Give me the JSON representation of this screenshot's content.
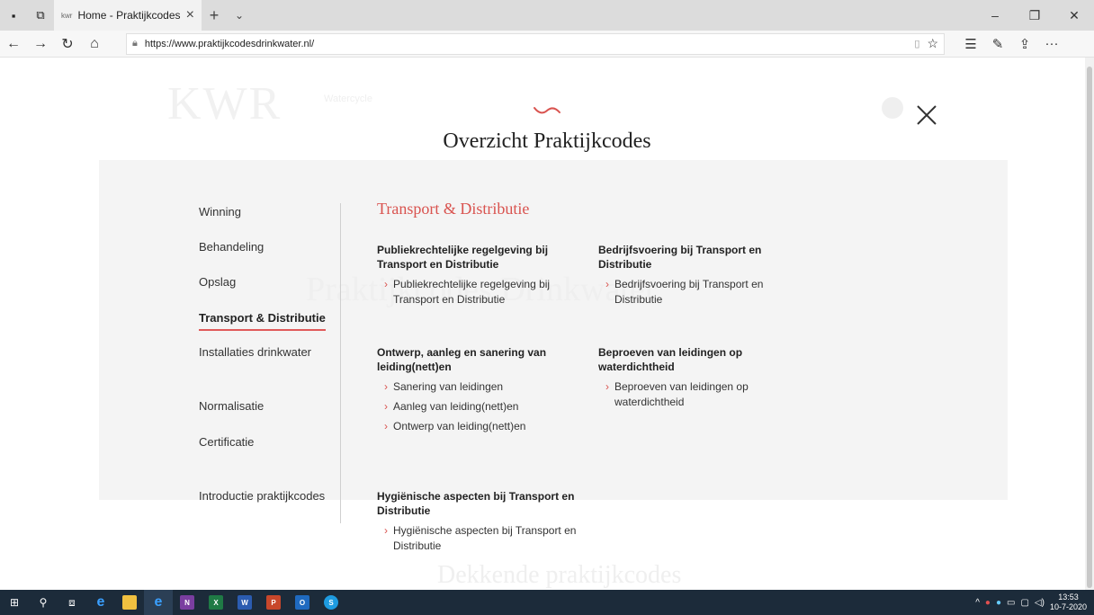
{
  "browser": {
    "tab_title": "Home - Praktijkcodes D",
    "tab_favicon": "kwr",
    "url": "https://www.praktijkcodesdrinkwater.nl/"
  },
  "overlay": {
    "title": "Overzicht Praktijkcodes",
    "menu": [
      "Winning",
      "Behandeling",
      "Opslag",
      "Transport & Distributie",
      "Installaties drinkwater",
      "Normalisatie",
      "Certificatie",
      "Introductie praktijkcodes"
    ],
    "active_menu": "Transport & Distributie",
    "section_title": "Transport & Distributie",
    "groups": [
      {
        "title": "Publiekrechtelijke regelgeving bij Transport en Distributie",
        "links": [
          "Publiekrechtelijke regelgeving bij Transport en Distributie"
        ]
      },
      {
        "title": "Bedrijfsvoering bij Transport en Distributie",
        "links": [
          "Bedrijfsvoering bij Transport en Distributie"
        ]
      },
      {
        "title": "Ontwerp, aanleg en sanering van leiding(nett)en",
        "links": [
          "Sanering van leidingen",
          "Aanleg van leiding(nett)en",
          "Ontwerp van leiding(nett)en"
        ]
      },
      {
        "title": "Beproeven van leidingen op waterdichtheid",
        "links": [
          "Beproeven van leidingen op waterdichtheid"
        ]
      },
      {
        "title": "Hygiënische aspecten bij Transport en Distributie",
        "links": [
          "Hygiënische aspecten bij Transport en Distributie"
        ]
      }
    ]
  },
  "background": {
    "logo": "KWR",
    "logo_sub": "Watercycle",
    "heading": "Praktijkcodes Drinkwater",
    "bottom_heading": "Dekkende praktijkcodes"
  },
  "taskbar": {
    "time": "13:53",
    "date": "10-7-2020"
  },
  "colors": {
    "accent": "#d9534f",
    "taskbar": "#1c2b3a"
  }
}
